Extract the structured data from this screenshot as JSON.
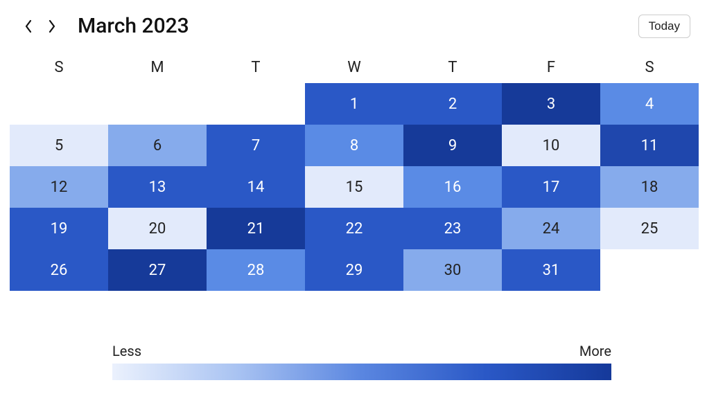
{
  "header": {
    "title": "March 2023",
    "today_label": "Today"
  },
  "days_of_week": [
    "S",
    "M",
    "T",
    "W",
    "T",
    "F",
    "S"
  ],
  "legend": {
    "less": "Less",
    "more": "More"
  },
  "chart_data": {
    "type": "heatmap",
    "title": "March 2023",
    "rows_are": "weeks",
    "columns": [
      "S",
      "M",
      "T",
      "W",
      "T",
      "F",
      "S"
    ],
    "value_scale_label_low": "Less",
    "value_scale_label_high": "More",
    "value_range": [
      0,
      9
    ],
    "cells": [
      [
        null,
        null,
        null,
        {
          "day": 1,
          "v": 7
        },
        {
          "day": 2,
          "v": 7
        },
        {
          "day": 3,
          "v": 9
        },
        {
          "day": 4,
          "v": 5
        }
      ],
      [
        {
          "day": 5,
          "v": 1
        },
        {
          "day": 6,
          "v": 4
        },
        {
          "day": 7,
          "v": 7
        },
        {
          "day": 8,
          "v": 5
        },
        {
          "day": 9,
          "v": 9
        },
        {
          "day": 10,
          "v": 1
        },
        {
          "day": 11,
          "v": 8
        }
      ],
      [
        {
          "day": 12,
          "v": 4
        },
        {
          "day": 13,
          "v": 7
        },
        {
          "day": 14,
          "v": 7
        },
        {
          "day": 15,
          "v": 1
        },
        {
          "day": 16,
          "v": 5
        },
        {
          "day": 17,
          "v": 7
        },
        {
          "day": 18,
          "v": 4
        }
      ],
      [
        {
          "day": 19,
          "v": 7
        },
        {
          "day": 20,
          "v": 1
        },
        {
          "day": 21,
          "v": 9
        },
        {
          "day": 22,
          "v": 7
        },
        {
          "day": 23,
          "v": 7
        },
        {
          "day": 24,
          "v": 4
        },
        {
          "day": 25,
          "v": 1
        }
      ],
      [
        {
          "day": 26,
          "v": 7
        },
        {
          "day": 27,
          "v": 9
        },
        {
          "day": 28,
          "v": 5
        },
        {
          "day": 29,
          "v": 7
        },
        {
          "day": 30,
          "v": 4
        },
        {
          "day": 31,
          "v": 7
        },
        null
      ]
    ],
    "color_stops": {
      "0": "#f3f7fe",
      "1": "#e2eafb",
      "2": "#c9d8f7",
      "3": "#a8c2f2",
      "4": "#86abec",
      "5": "#5a8be5",
      "6": "#3d6fd8",
      "7": "#2a58c6",
      "8": "#1f47ad",
      "9": "#163a99"
    }
  }
}
